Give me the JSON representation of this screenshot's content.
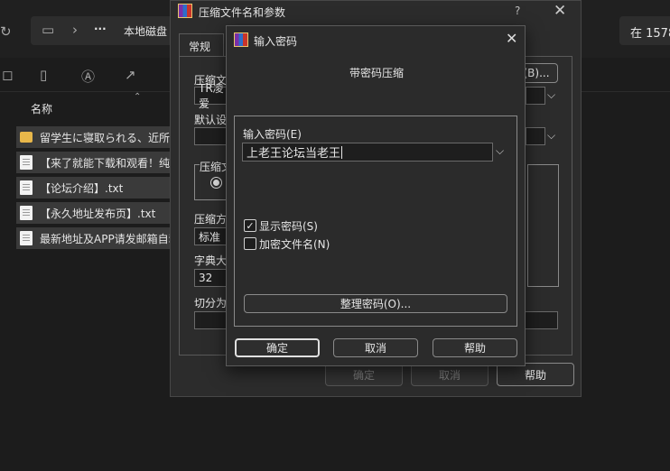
{
  "explorer": {
    "breadcrumb_text": "本地磁盘",
    "more": "···",
    "search_text": "在 1578",
    "column_name": "名称",
    "files": [
      {
        "name": "留学生に寝取られる、近所の"
      },
      {
        "name": "【来了就能下载和观看！纯"
      },
      {
        "name": "【论坛介绍】.txt"
      },
      {
        "name": "【永久地址发布页】.txt"
      },
      {
        "name": "最新地址及APP请发邮箱自动"
      }
    ]
  },
  "archive_dialog": {
    "title": "压缩文件名和参数",
    "help_glyph": "?",
    "tab_general": "常规",
    "label_archive_name": "压缩文",
    "archive_name_value": "TR凌爱",
    "browse_label": "(B)...",
    "label_default": "默认设",
    "label_format": "压缩文",
    "label_method": "压缩方",
    "method_value": "标准",
    "label_dict": "字典大",
    "dict_value": "32",
    "label_split": "切分为",
    "ok": "确定",
    "cancel": "取消",
    "help": "帮助"
  },
  "password_dialog": {
    "title": "输入密码",
    "subtitle": "带密码压缩",
    "label_password": "输入密码(E)",
    "password_value": "上老王论坛当老王",
    "show_password": "显示密码(S)",
    "show_password_checked": true,
    "encrypt_names": "加密文件名(N)",
    "encrypt_names_checked": false,
    "organize": "整理密码(O)...",
    "ok": "确定",
    "cancel": "取消",
    "help": "帮助"
  }
}
